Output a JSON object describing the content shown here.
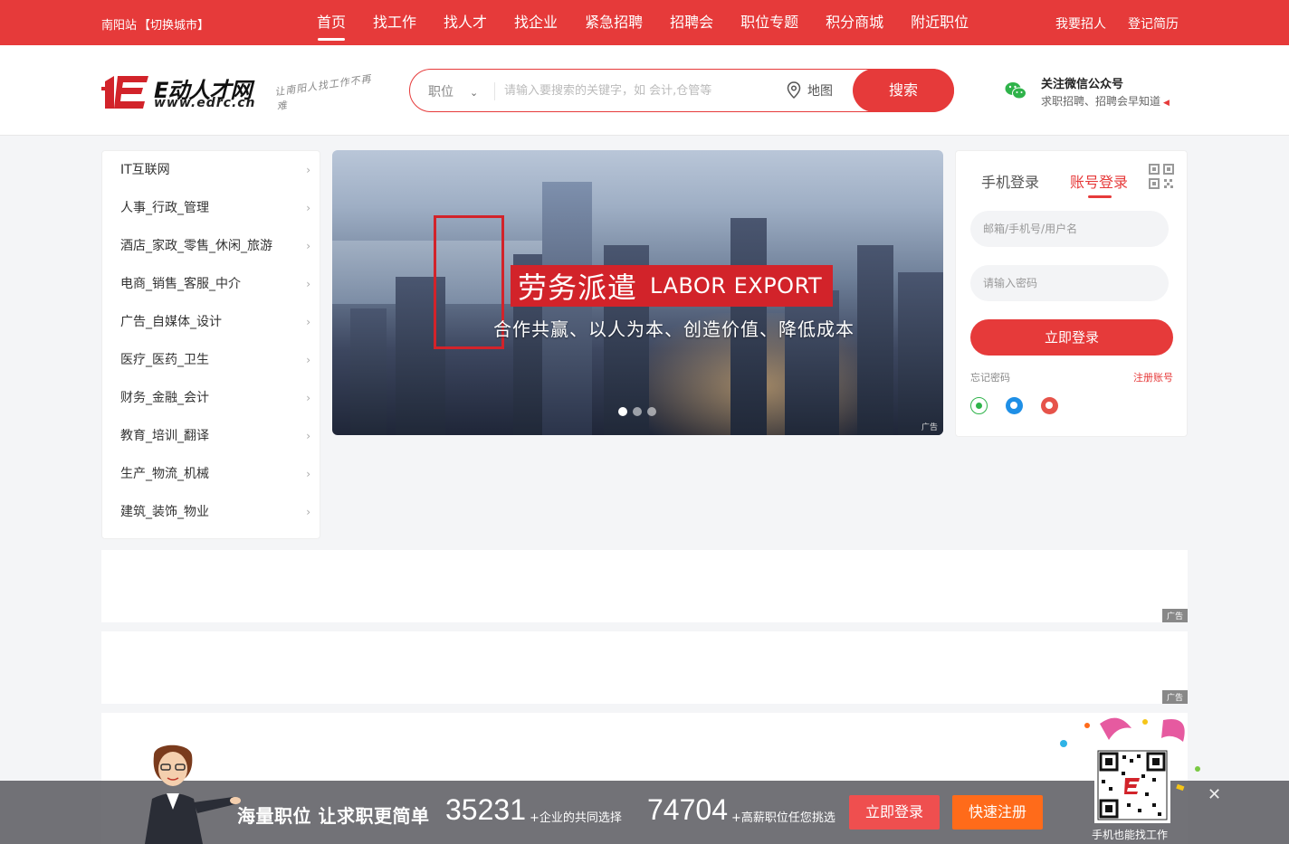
{
  "topbar": {
    "city": "南阳站",
    "switch_city": "【切换城市】",
    "nav": [
      "首页",
      "找工作",
      "找人才",
      "找企业",
      "紧急招聘",
      "招聘会",
      "职位专题",
      "积分商城",
      "附近职位"
    ],
    "recruit": "我要招人",
    "register_resume": "登记简历"
  },
  "header": {
    "logo_brand": "E动人才网",
    "logo_url": "www.edrc.cn",
    "logo_slogan": "让南阳人找工作不再难",
    "search": {
      "category": "职位",
      "placeholder": "请输入要搜索的关键字，如 会计,仓管等",
      "map_label": "地图",
      "button": "搜索"
    },
    "wechat": {
      "title": "关注微信公众号",
      "subtitle": "求职招聘、招聘会早知道"
    }
  },
  "categories": [
    "IT互联网",
    "人事_行政_管理",
    "酒店_家政_零售_休闲_旅游",
    "电商_销售_客服_中介",
    "广告_自媒体_设计",
    "医疗_医药_卫生",
    "财务_金融_会计",
    "教育_培训_翻译",
    "生产_物流_机械",
    "建筑_装饰_物业"
  ],
  "banner": {
    "title_zh": "劳务派遣",
    "title_en": "LABOR EXPORT",
    "subtitle": "合作共赢、以人为本、创造价值、降低成本",
    "ad_label": "广告",
    "slide_count": 3,
    "active_slide": 1
  },
  "login": {
    "tab_phone": "手机登录",
    "tab_account": "账号登录",
    "username_placeholder": "邮箱/手机号/用户名",
    "password_placeholder": "请输入密码",
    "submit": "立即登录",
    "forgot": "忘记密码",
    "register": "注册账号"
  },
  "ads": {
    "tag": "广告"
  },
  "floatbar": {
    "slogan": "海量职位 让求职更简单",
    "count1": "35231",
    "count1_desc": "+企业的共同选择",
    "count2": "74704",
    "count2_desc": "+高薪职位任您挑选",
    "login_btn": "立即登录",
    "register_btn": "快速注册",
    "qr_caption": "手机也能找工作"
  },
  "colors": {
    "brand": "#e63a3a",
    "orange": "#ff6b1a"
  }
}
